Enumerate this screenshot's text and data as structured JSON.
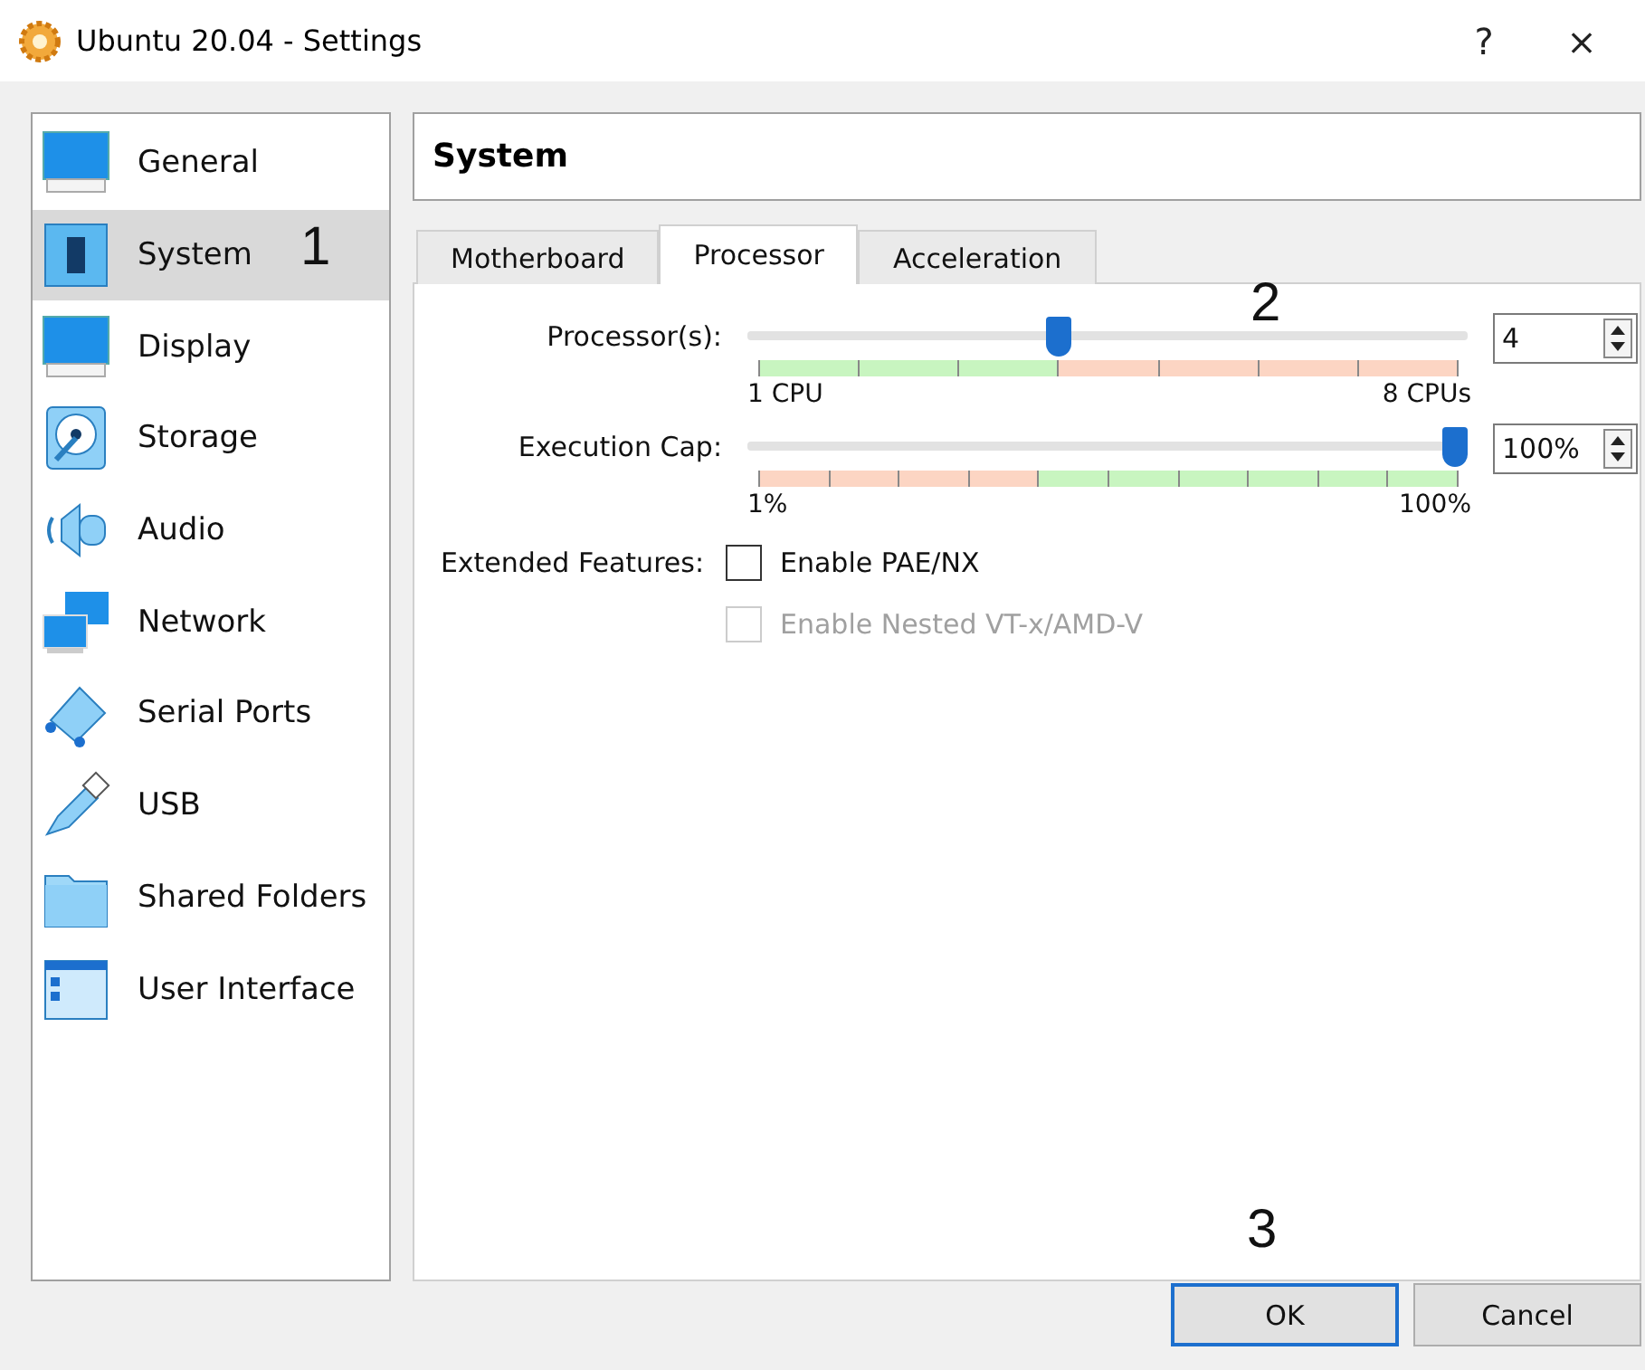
{
  "window": {
    "title": "Ubuntu 20.04 - Settings",
    "help": "?",
    "close": "×"
  },
  "sidebar": {
    "items": [
      {
        "label": "General",
        "kind": "general",
        "selected": false
      },
      {
        "label": "System",
        "kind": "system",
        "selected": true,
        "annotation": "1"
      },
      {
        "label": "Display",
        "kind": "display",
        "selected": false
      },
      {
        "label": "Storage",
        "kind": "storage",
        "selected": false
      },
      {
        "label": "Audio",
        "kind": "audio",
        "selected": false
      },
      {
        "label": "Network",
        "kind": "network",
        "selected": false
      },
      {
        "label": "Serial Ports",
        "kind": "serial",
        "selected": false
      },
      {
        "label": "USB",
        "kind": "usb",
        "selected": false
      },
      {
        "label": "Shared Folders",
        "kind": "folders",
        "selected": false
      },
      {
        "label": "User Interface",
        "kind": "ui",
        "selected": false
      }
    ]
  },
  "page_title": "System",
  "tabs": [
    {
      "label": "Motherboard",
      "selected": false
    },
    {
      "label": "Processor",
      "selected": true
    },
    {
      "label": "Acceleration",
      "selected": false
    }
  ],
  "sliders": [
    {
      "label": "Processor(s):",
      "kind": "cpu",
      "level": 0.43,
      "min_label": "1 CPU",
      "max_label": "8 CPUs",
      "value": "4",
      "annotation": "2"
    },
    {
      "label": "Execution Cap:",
      "kind": "cap",
      "level": 1.0,
      "min_label": "1%",
      "max_label": "100%",
      "value": "100%"
    }
  ],
  "extended_features": {
    "label": "Extended Features:",
    "options": [
      {
        "label": "Enable PAE/NX",
        "checked": false,
        "disabled": false
      },
      {
        "label": "Enable Nested VT-x/AMD-V",
        "checked": false,
        "disabled": true
      }
    ]
  },
  "buttons": [
    {
      "label": "OK",
      "default": true,
      "annotation": "3"
    },
    {
      "label": "Cancel",
      "default": false
    }
  ]
}
